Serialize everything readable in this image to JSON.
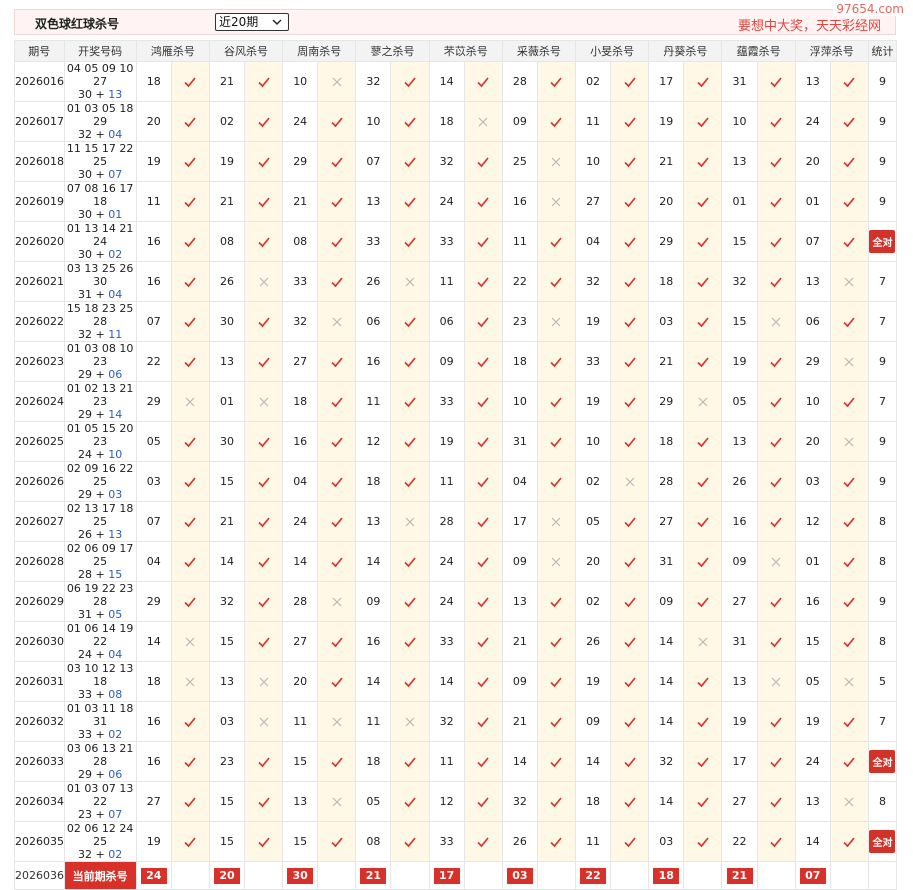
{
  "header": {
    "title": "双色球红球杀号",
    "period_select": "近20期",
    "slogan": "要想中大奖，天天彩经网",
    "watermark": "97654.com"
  },
  "columns": [
    "期号",
    "开奖号码",
    "鸿雁杀号",
    "谷风杀号",
    "周南杀号",
    "蓼之杀号",
    "芣苡杀号",
    "采薇杀号",
    "小旻杀号",
    "丹葵杀号",
    "蕴霞杀号",
    "浮萍杀号",
    "统计"
  ],
  "rows": [
    {
      "period": "2026016",
      "red_line1": "04 05 09 10 27",
      "red_line2": "30",
      "blue": "13",
      "kills": [
        [
          "18",
          "y"
        ],
        [
          "21",
          "y"
        ],
        [
          "10",
          "n"
        ],
        [
          "32",
          "y"
        ],
        [
          "14",
          "y"
        ],
        [
          "28",
          "y"
        ],
        [
          "02",
          "y"
        ],
        [
          "17",
          "y"
        ],
        [
          "31",
          "y"
        ],
        [
          "13",
          "y"
        ]
      ],
      "stat": "9"
    },
    {
      "period": "2026017",
      "red_line1": "01 03 05 18 29",
      "red_line2": "32",
      "blue": "04",
      "kills": [
        [
          "20",
          "y"
        ],
        [
          "02",
          "y"
        ],
        [
          "24",
          "y"
        ],
        [
          "10",
          "y"
        ],
        [
          "18",
          "n"
        ],
        [
          "09",
          "y"
        ],
        [
          "11",
          "y"
        ],
        [
          "19",
          "y"
        ],
        [
          "10",
          "y"
        ],
        [
          "24",
          "y"
        ]
      ],
      "stat": "9"
    },
    {
      "period": "2026018",
      "red_line1": "11 15 17 22 25",
      "red_line2": "30",
      "blue": "07",
      "kills": [
        [
          "19",
          "y"
        ],
        [
          "19",
          "y"
        ],
        [
          "29",
          "y"
        ],
        [
          "07",
          "y"
        ],
        [
          "32",
          "y"
        ],
        [
          "25",
          "n"
        ],
        [
          "10",
          "y"
        ],
        [
          "21",
          "y"
        ],
        [
          "13",
          "y"
        ],
        [
          "20",
          "y"
        ]
      ],
      "stat": "9"
    },
    {
      "period": "2026019",
      "red_line1": "07 08 16 17 18",
      "red_line2": "30",
      "blue": "01",
      "kills": [
        [
          "11",
          "y"
        ],
        [
          "21",
          "y"
        ],
        [
          "21",
          "y"
        ],
        [
          "13",
          "y"
        ],
        [
          "24",
          "y"
        ],
        [
          "16",
          "n"
        ],
        [
          "27",
          "y"
        ],
        [
          "20",
          "y"
        ],
        [
          "01",
          "y"
        ],
        [
          "01",
          "y"
        ]
      ],
      "stat": "9"
    },
    {
      "period": "2026020",
      "red_line1": "01 13 14 21 24",
      "red_line2": "30",
      "blue": "02",
      "kills": [
        [
          "16",
          "y"
        ],
        [
          "08",
          "y"
        ],
        [
          "08",
          "y"
        ],
        [
          "33",
          "y"
        ],
        [
          "33",
          "y"
        ],
        [
          "11",
          "y"
        ],
        [
          "04",
          "y"
        ],
        [
          "29",
          "y"
        ],
        [
          "15",
          "y"
        ],
        [
          "07",
          "y"
        ]
      ],
      "stat": "全对"
    },
    {
      "period": "2026021",
      "red_line1": "03 13 25 26 30",
      "red_line2": "31",
      "blue": "04",
      "kills": [
        [
          "16",
          "y"
        ],
        [
          "26",
          "n"
        ],
        [
          "33",
          "y"
        ],
        [
          "26",
          "n"
        ],
        [
          "11",
          "y"
        ],
        [
          "22",
          "y"
        ],
        [
          "32",
          "y"
        ],
        [
          "18",
          "y"
        ],
        [
          "32",
          "y"
        ],
        [
          "13",
          "n"
        ]
      ],
      "stat": "7"
    },
    {
      "period": "2026022",
      "red_line1": "15 18 23 25 28",
      "red_line2": "32",
      "blue": "11",
      "kills": [
        [
          "07",
          "y"
        ],
        [
          "30",
          "y"
        ],
        [
          "32",
          "n"
        ],
        [
          "06",
          "y"
        ],
        [
          "06",
          "y"
        ],
        [
          "23",
          "n"
        ],
        [
          "19",
          "y"
        ],
        [
          "03",
          "y"
        ],
        [
          "15",
          "n"
        ],
        [
          "06",
          "y"
        ]
      ],
      "stat": "7"
    },
    {
      "period": "2026023",
      "red_line1": "01 03 08 10 23",
      "red_line2": "29",
      "blue": "06",
      "kills": [
        [
          "22",
          "y"
        ],
        [
          "13",
          "y"
        ],
        [
          "27",
          "y"
        ],
        [
          "16",
          "y"
        ],
        [
          "09",
          "y"
        ],
        [
          "18",
          "y"
        ],
        [
          "33",
          "y"
        ],
        [
          "21",
          "y"
        ],
        [
          "19",
          "y"
        ],
        [
          "29",
          "n"
        ]
      ],
      "stat": "9"
    },
    {
      "period": "2026024",
      "red_line1": "01 02 13 21 23",
      "red_line2": "29",
      "blue": "14",
      "kills": [
        [
          "29",
          "n"
        ],
        [
          "01",
          "n"
        ],
        [
          "18",
          "y"
        ],
        [
          "11",
          "y"
        ],
        [
          "33",
          "y"
        ],
        [
          "10",
          "y"
        ],
        [
          "19",
          "y"
        ],
        [
          "29",
          "n"
        ],
        [
          "05",
          "y"
        ],
        [
          "10",
          "y"
        ]
      ],
      "stat": "7"
    },
    {
      "period": "2026025",
      "red_line1": "01 05 15 20 23",
      "red_line2": "24",
      "blue": "10",
      "kills": [
        [
          "05",
          "y"
        ],
        [
          "30",
          "y"
        ],
        [
          "16",
          "y"
        ],
        [
          "12",
          "y"
        ],
        [
          "19",
          "y"
        ],
        [
          "31",
          "y"
        ],
        [
          "10",
          "y"
        ],
        [
          "18",
          "y"
        ],
        [
          "13",
          "y"
        ],
        [
          "20",
          "n"
        ]
      ],
      "stat": "9"
    },
    {
      "period": "2026026",
      "red_line1": "02 09 16 22 25",
      "red_line2": "29",
      "blue": "03",
      "kills": [
        [
          "03",
          "y"
        ],
        [
          "15",
          "y"
        ],
        [
          "04",
          "y"
        ],
        [
          "18",
          "y"
        ],
        [
          "11",
          "y"
        ],
        [
          "04",
          "y"
        ],
        [
          "02",
          "n"
        ],
        [
          "28",
          "y"
        ],
        [
          "26",
          "y"
        ],
        [
          "03",
          "y"
        ]
      ],
      "stat": "9"
    },
    {
      "period": "2026027",
      "red_line1": "02 13 17 18 25",
      "red_line2": "26",
      "blue": "13",
      "kills": [
        [
          "07",
          "y"
        ],
        [
          "21",
          "y"
        ],
        [
          "24",
          "y"
        ],
        [
          "13",
          "n"
        ],
        [
          "28",
          "y"
        ],
        [
          "17",
          "n"
        ],
        [
          "05",
          "y"
        ],
        [
          "27",
          "y"
        ],
        [
          "16",
          "y"
        ],
        [
          "12",
          "y"
        ]
      ],
      "stat": "8"
    },
    {
      "period": "2026028",
      "red_line1": "02 06 09 17 25",
      "red_line2": "28",
      "blue": "15",
      "kills": [
        [
          "04",
          "y"
        ],
        [
          "14",
          "y"
        ],
        [
          "14",
          "y"
        ],
        [
          "14",
          "y"
        ],
        [
          "24",
          "y"
        ],
        [
          "09",
          "n"
        ],
        [
          "20",
          "y"
        ],
        [
          "31",
          "y"
        ],
        [
          "09",
          "n"
        ],
        [
          "01",
          "y"
        ]
      ],
      "stat": "8"
    },
    {
      "period": "2026029",
      "red_line1": "06 19 22 23 28",
      "red_line2": "31",
      "blue": "05",
      "kills": [
        [
          "29",
          "y"
        ],
        [
          "32",
          "y"
        ],
        [
          "28",
          "n"
        ],
        [
          "09",
          "y"
        ],
        [
          "24",
          "y"
        ],
        [
          "13",
          "y"
        ],
        [
          "02",
          "y"
        ],
        [
          "09",
          "y"
        ],
        [
          "27",
          "y"
        ],
        [
          "16",
          "y"
        ]
      ],
      "stat": "9"
    },
    {
      "period": "2026030",
      "red_line1": "01 06 14 19 22",
      "red_line2": "24",
      "blue": "04",
      "kills": [
        [
          "14",
          "n"
        ],
        [
          "15",
          "y"
        ],
        [
          "27",
          "y"
        ],
        [
          "16",
          "y"
        ],
        [
          "33",
          "y"
        ],
        [
          "21",
          "y"
        ],
        [
          "26",
          "y"
        ],
        [
          "14",
          "n"
        ],
        [
          "31",
          "y"
        ],
        [
          "15",
          "y"
        ]
      ],
      "stat": "8"
    },
    {
      "period": "2026031",
      "red_line1": "03 10 12 13 18",
      "red_line2": "33",
      "blue": "08",
      "kills": [
        [
          "18",
          "n"
        ],
        [
          "13",
          "n"
        ],
        [
          "20",
          "y"
        ],
        [
          "14",
          "y"
        ],
        [
          "14",
          "y"
        ],
        [
          "09",
          "y"
        ],
        [
          "19",
          "y"
        ],
        [
          "14",
          "y"
        ],
        [
          "13",
          "n"
        ],
        [
          "05",
          "n"
        ]
      ],
      "stat": "5"
    },
    {
      "period": "2026032",
      "red_line1": "01 03 11 18 31",
      "red_line2": "33",
      "blue": "02",
      "kills": [
        [
          "16",
          "y"
        ],
        [
          "03",
          "n"
        ],
        [
          "11",
          "n"
        ],
        [
          "11",
          "n"
        ],
        [
          "32",
          "y"
        ],
        [
          "21",
          "y"
        ],
        [
          "09",
          "y"
        ],
        [
          "14",
          "y"
        ],
        [
          "19",
          "y"
        ],
        [
          "19",
          "y"
        ]
      ],
      "stat": "7"
    },
    {
      "period": "2026033",
      "red_line1": "03 06 13 21 28",
      "red_line2": "29",
      "blue": "06",
      "kills": [
        [
          "16",
          "y"
        ],
        [
          "23",
          "y"
        ],
        [
          "15",
          "y"
        ],
        [
          "18",
          "y"
        ],
        [
          "11",
          "y"
        ],
        [
          "14",
          "y"
        ],
        [
          "14",
          "y"
        ],
        [
          "32",
          "y"
        ],
        [
          "17",
          "y"
        ],
        [
          "24",
          "y"
        ]
      ],
      "stat": "全对"
    },
    {
      "period": "2026034",
      "red_line1": "01 03 07 13 22",
      "red_line2": "23",
      "blue": "07",
      "kills": [
        [
          "27",
          "y"
        ],
        [
          "15",
          "y"
        ],
        [
          "13",
          "n"
        ],
        [
          "05",
          "y"
        ],
        [
          "12",
          "y"
        ],
        [
          "32",
          "y"
        ],
        [
          "18",
          "y"
        ],
        [
          "14",
          "y"
        ],
        [
          "27",
          "y"
        ],
        [
          "13",
          "n"
        ]
      ],
      "stat": "8"
    },
    {
      "period": "2026035",
      "red_line1": "02 06 12 24 25",
      "red_line2": "32",
      "blue": "02",
      "kills": [
        [
          "19",
          "y"
        ],
        [
          "15",
          "y"
        ],
        [
          "15",
          "y"
        ],
        [
          "08",
          "y"
        ],
        [
          "33",
          "y"
        ],
        [
          "26",
          "y"
        ],
        [
          "11",
          "y"
        ],
        [
          "03",
          "y"
        ],
        [
          "22",
          "y"
        ],
        [
          "14",
          "y"
        ]
      ],
      "stat": "全对"
    }
  ],
  "current": {
    "period": "2026036",
    "label": "当前期杀号",
    "kills": [
      "24",
      "20",
      "30",
      "21",
      "17",
      "03",
      "22",
      "18",
      "21",
      "07"
    ]
  },
  "colors": {
    "accent": "#d7312a",
    "mark_bg": "#fff8e6",
    "header_bg": "#f3f3f3",
    "title_bg": "#fff3f3"
  }
}
